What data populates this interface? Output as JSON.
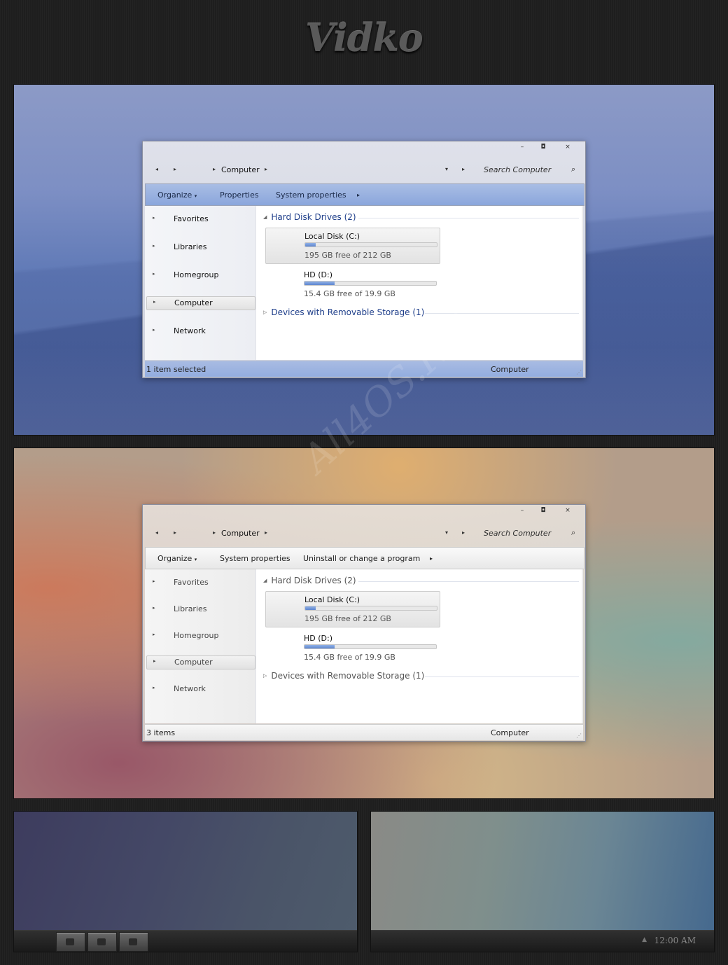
{
  "page_title": "Vidko",
  "watermark": "All4OS.RU",
  "icons": [
    "back-icon",
    "forward-icon",
    "breadcrumb-arrow-icon",
    "dropdown-icon",
    "search-icon",
    "minimize-icon",
    "maximize-icon",
    "close-icon",
    "expand-icon",
    "collapse-icon"
  ],
  "colors": {
    "accent_blue": "#8aa6dc",
    "link_blue": "#1e3e8a",
    "drive_fill": "#5e86cf"
  },
  "window1": {
    "caption": {
      "min": "–",
      "max": "◘",
      "close": "×"
    },
    "nav": {
      "back": "◂",
      "forward": "▸",
      "crumb_sep": "▸",
      "crumb": "Computer",
      "crumb_arrow": "▸",
      "history": "▾",
      "refresh": "▸"
    },
    "search_placeholder": "Search Computer",
    "search_icon": "⌕",
    "commands": {
      "organize": "Organize",
      "organize_arrow": "▾",
      "item2": "Properties",
      "item3": "System properties",
      "more": "▸"
    },
    "sidebar": [
      {
        "label": "Favorites"
      },
      {
        "label": "Libraries"
      },
      {
        "label": "Homegroup"
      },
      {
        "label": "Computer"
      },
      {
        "label": "Network"
      }
    ],
    "tree_arrow": "▸",
    "groups": {
      "hdd": "Hard Disk Drives (2)",
      "hdd_tri": "◢",
      "removable": "Devices with Removable Storage (1)",
      "removable_tri": "▷"
    },
    "drives": [
      {
        "name": "Local Disk (C:)",
        "info": "195 GB free of 212 GB",
        "used_fraction": 0.08
      },
      {
        "name": "HD (D:)",
        "info": "15.4 GB free of 19.9 GB",
        "used_fraction": 0.23
      }
    ],
    "status": {
      "left": "1 item selected",
      "right": "Computer",
      "grip": "⋰"
    }
  },
  "window2": {
    "caption": {
      "min": "–",
      "max": "◘",
      "close": "×"
    },
    "nav": {
      "back": "◂",
      "forward": "▸",
      "crumb_sep": "▸",
      "crumb": "Computer",
      "crumb_arrow": "▸",
      "history": "▾",
      "refresh": "▸"
    },
    "search_placeholder": "Search Computer",
    "search_icon": "⌕",
    "commands": {
      "organize": "Organize",
      "organize_arrow": "▾",
      "item2": "System properties",
      "item3": "Uninstall or change a program",
      "more": "▸"
    },
    "sidebar": [
      {
        "label": "Favorites"
      },
      {
        "label": "Libraries"
      },
      {
        "label": "Homegroup"
      },
      {
        "label": "Computer"
      },
      {
        "label": "Network"
      }
    ],
    "tree_arrow": "▸",
    "groups": {
      "hdd": "Hard Disk Drives (2)",
      "hdd_tri": "◢",
      "removable": "Devices with Removable Storage (1)",
      "removable_tri": "▷"
    },
    "drives": [
      {
        "name": "Local Disk (C:)",
        "info": "195 GB free of 212 GB",
        "used_fraction": 0.08
      },
      {
        "name": "HD (D:)",
        "info": "15.4 GB free of 19.9 GB",
        "used_fraction": 0.23
      }
    ],
    "status": {
      "left": "3 items",
      "right": "Computer",
      "grip": "⋰"
    }
  },
  "taskbar": {
    "tray_arrow": "▲",
    "clock": "12:00 AM",
    "pinned_count": 3
  }
}
